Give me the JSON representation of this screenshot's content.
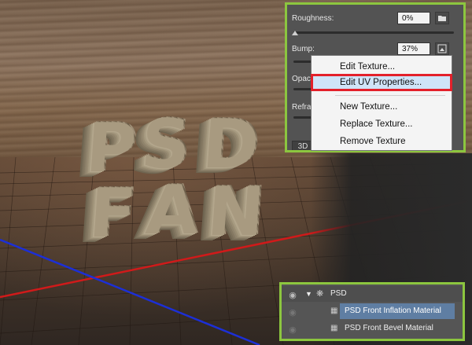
{
  "properties": {
    "roughness_label": "Roughness:",
    "roughness_value": "0%",
    "roughness_level": 0.0,
    "bump_label": "Bump:",
    "bump_value": "37%",
    "bump_level": 0.37,
    "opacity_label_partial": "Opaci",
    "refraction_label_partial": "Refrac",
    "tab_3d": "3D",
    "folder_icon": "folder-icon",
    "texture_icon": "texture-edit-icon"
  },
  "context_menu": {
    "items": [
      {
        "label": "Edit Texture..."
      },
      {
        "label": "Edit UV Properties...",
        "highlighted": true
      },
      {
        "label": "New Texture..."
      },
      {
        "label": "Replace Texture..."
      },
      {
        "label": "Remove Texture"
      }
    ]
  },
  "layers": {
    "group_name": "PSD",
    "materials": [
      {
        "name": "PSD Front Inflation Material",
        "selected": true
      },
      {
        "name": "PSD Front Bevel Material",
        "selected": false
      }
    ]
  },
  "scene": {
    "text_line1": [
      "P",
      "S",
      "D"
    ],
    "text_line2": [
      "F",
      "A",
      "N"
    ]
  },
  "colors": {
    "highlight_border": "#8cc63f",
    "menu_selection_outline": "#e3202a",
    "menu_selection_fill": "#cfe4f8"
  }
}
